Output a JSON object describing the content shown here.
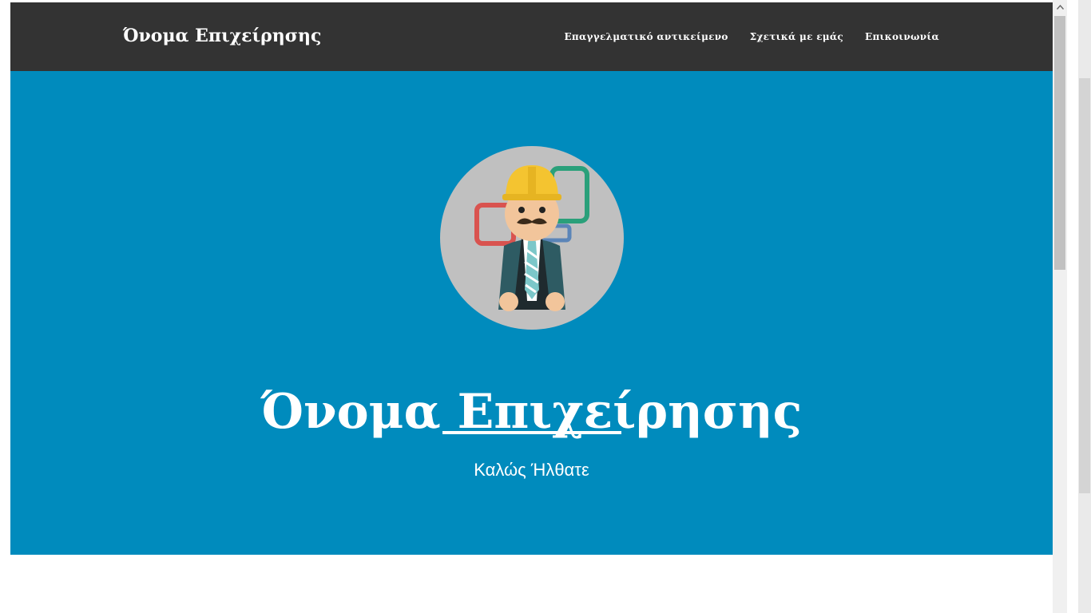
{
  "navbar": {
    "brand": "Όνομα Επιχείρησης",
    "links": [
      "Επαγγελματικό αντικείμενο",
      "Σχετικά με εμάς",
      "Επικοινωνία"
    ]
  },
  "hero": {
    "avatar_icon": "construction-worker-avatar",
    "title": "Όνομα Επιχείρησης",
    "subtitle": "Καλώς Ήλθατε"
  },
  "colors": {
    "navbar_bg": "#333333",
    "hero_bg": "#008bbd",
    "avatar_bg": "#c0c0c0",
    "text": "#ffffff"
  }
}
